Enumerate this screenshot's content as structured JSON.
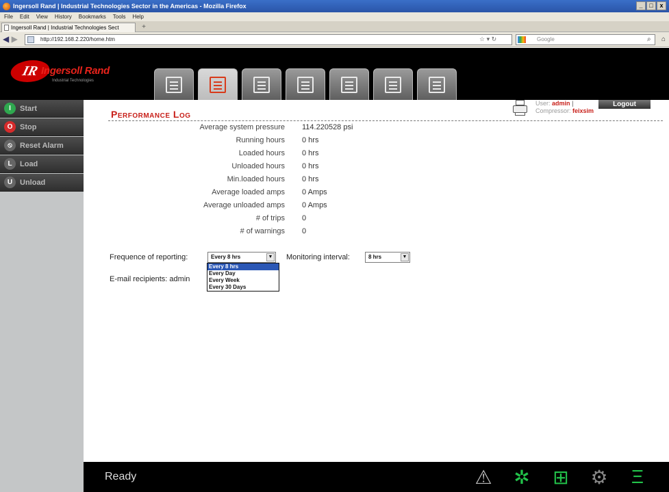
{
  "browser": {
    "window_title": "Ingersoll Rand | Industrial Technologies Sector in the Americas - Mozilla Firefox",
    "window_controls": [
      "_",
      "□",
      "x"
    ],
    "menu": [
      "File",
      "Edit",
      "View",
      "History",
      "Bookmarks",
      "Tools",
      "Help"
    ],
    "tab_label": "Ingersoll Rand | Industrial Technologies Sect",
    "new_tab": "+",
    "url": "http://192.168.2.220/home.htm",
    "search_placeholder": "Google",
    "icons": [
      "back-icon",
      "forward-icon",
      "refresh-icon",
      "search-icon",
      "home-icon"
    ]
  },
  "header": {
    "logo_mark": "IR",
    "brand": "Ingersoll Rand",
    "tagline": "Industrial Technologies",
    "tabs": [
      {
        "icon": "status-icon",
        "active": false
      },
      {
        "icon": "log-icon",
        "active": true
      },
      {
        "icon": "chart-icon",
        "active": false
      },
      {
        "icon": "settings-icon",
        "active": false
      },
      {
        "icon": "search-doc-icon",
        "active": false
      },
      {
        "icon": "info-icon",
        "active": false
      },
      {
        "icon": "user-card-icon",
        "active": false
      }
    ]
  },
  "sidebar": {
    "items": [
      {
        "label": "Start",
        "icon": "power-icon",
        "color": "#2fa84f",
        "symbol": "I"
      },
      {
        "label": "Stop",
        "icon": "stop-icon",
        "color": "#d62b2b",
        "symbol": "O"
      },
      {
        "label": "Reset Alarm",
        "icon": "reset-icon",
        "color": "#666666",
        "symbol": "⃠"
      },
      {
        "label": "Load",
        "icon": "load-icon",
        "color": "#666666",
        "symbol": "L"
      },
      {
        "label": "Unload",
        "icon": "unload-icon",
        "color": "#666666",
        "symbol": "U"
      }
    ]
  },
  "main": {
    "title": "Performance Log",
    "user_label": "User:",
    "user_value": "admin",
    "separator": "|",
    "compressor_label": "Compressor:",
    "compressor_value": "feixsim",
    "logout": "Logout",
    "stats": [
      {
        "label": "Average system pressure",
        "value": "114.220528 psi"
      },
      {
        "label": "Running hours",
        "value": "0 hrs"
      },
      {
        "label": "Loaded hours",
        "value": "0 hrs"
      },
      {
        "label": "Unloaded hours",
        "value": "0 hrs"
      },
      {
        "label": "Min.loaded hours",
        "value": "0 hrs"
      },
      {
        "label": "Average loaded amps",
        "value": "0 Amps"
      },
      {
        "label": "Average unloaded amps",
        "value": "0 Amps"
      },
      {
        "label": "# of trips",
        "value": "0"
      },
      {
        "label": "# of warnings",
        "value": "0"
      }
    ],
    "reporting_label": "Frequence of reporting:",
    "reporting_value": "Every 8 hrs",
    "reporting_options": [
      "Every 8 hrs",
      "Every Day",
      "Every Week",
      "Every 30 Days"
    ],
    "monitoring_label": "Monitoring interval:",
    "monitoring_value": "8 hrs",
    "email_label": "E-mail recipients:",
    "email_value": "admin"
  },
  "footer": {
    "status": "Ready",
    "icons": [
      {
        "name": "warning-icon",
        "color": "#bbbbbb"
      },
      {
        "name": "fan-icon",
        "color": "#22c24a"
      },
      {
        "name": "network-icon",
        "color": "#22c24a"
      },
      {
        "name": "service-icon",
        "color": "#888888"
      },
      {
        "name": "compressor-icon",
        "color": "#22c24a"
      }
    ]
  }
}
